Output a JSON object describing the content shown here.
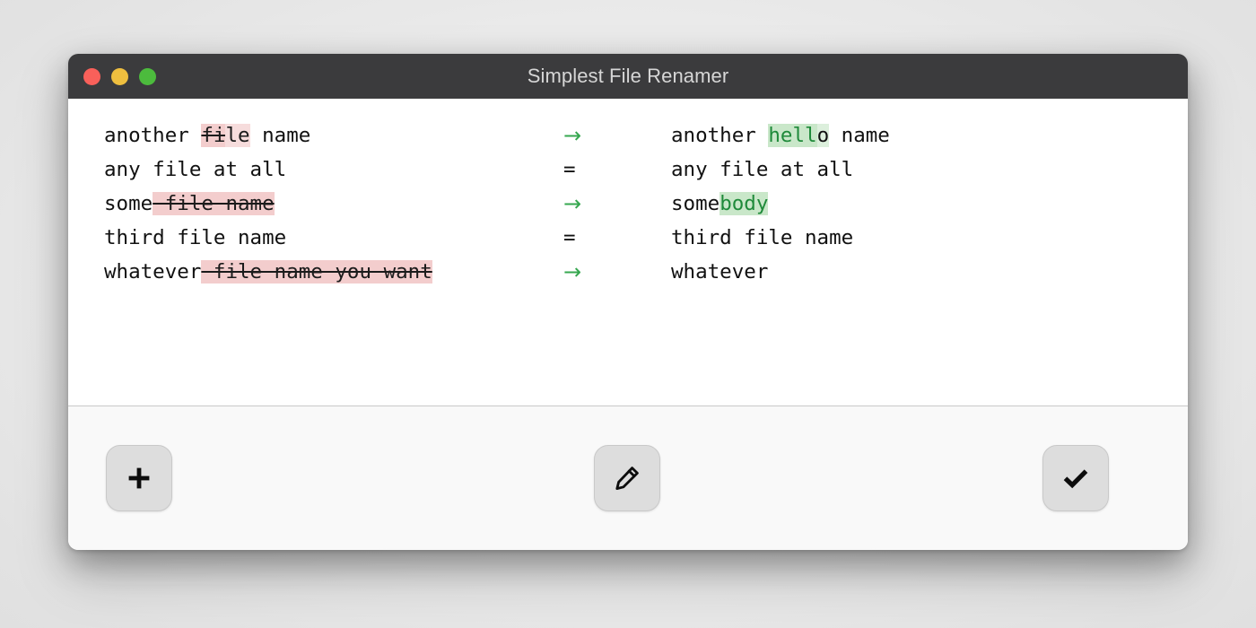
{
  "window": {
    "title": "Simplest File Renamer",
    "traffic_lights": [
      {
        "name": "close",
        "color": "#f9605a"
      },
      {
        "name": "minimize",
        "color": "#efbf3f"
      },
      {
        "name": "maximize",
        "color": "#4cbb3d"
      }
    ]
  },
  "colors": {
    "titlebar_bg": "#3b3b3d",
    "title_text": "#d6d6d6",
    "body_bg": "#ffffff",
    "toolbar_bg": "#f9f9f9",
    "delete_highlight": "#f3cdcd",
    "insert_highlight": "#c9e7c9",
    "insert_text": "#1f8a3a",
    "arrow_green": "#36a74f",
    "button_bg": "#dddddd"
  },
  "operators": {
    "changed": "→",
    "unchanged": "="
  },
  "rows": [
    {
      "id": "row-1",
      "operator": "changed",
      "old": [
        {
          "text": "another ",
          "kind": "same"
        },
        {
          "text": "fi",
          "kind": "del"
        },
        {
          "text": "le",
          "kind": "del-plain"
        },
        {
          "text": " name",
          "kind": "same"
        }
      ],
      "new": [
        {
          "text": "another ",
          "kind": "same"
        },
        {
          "text": "hell",
          "kind": "ins"
        },
        {
          "text": "o",
          "kind": "ins-plain"
        },
        {
          "text": " name",
          "kind": "same"
        }
      ],
      "old_plain": "another file name",
      "new_plain": "another hello name"
    },
    {
      "id": "row-2",
      "operator": "unchanged",
      "old": [
        {
          "text": "any file at all",
          "kind": "same"
        }
      ],
      "new": [
        {
          "text": "any file at all",
          "kind": "same"
        }
      ],
      "old_plain": "any file at all",
      "new_plain": "any file at all"
    },
    {
      "id": "row-3",
      "operator": "changed",
      "old": [
        {
          "text": "some",
          "kind": "same"
        },
        {
          "text": " file name",
          "kind": "del"
        }
      ],
      "new": [
        {
          "text": "some",
          "kind": "same"
        },
        {
          "text": "body",
          "kind": "ins"
        }
      ],
      "old_plain": "some file name",
      "new_plain": "somebody"
    },
    {
      "id": "row-4",
      "operator": "unchanged",
      "old": [
        {
          "text": "third file name",
          "kind": "same"
        }
      ],
      "new": [
        {
          "text": "third file name",
          "kind": "same"
        }
      ],
      "old_plain": "third file name",
      "new_plain": "third file name"
    },
    {
      "id": "row-5",
      "operator": "changed",
      "old": [
        {
          "text": "whatever",
          "kind": "same"
        },
        {
          "text": " file name you want",
          "kind": "del"
        }
      ],
      "new": [
        {
          "text": "whatever",
          "kind": "same"
        }
      ],
      "old_plain": "whatever file name you want",
      "new_plain": "whatever"
    }
  ],
  "toolbar": {
    "buttons": [
      {
        "id": "add",
        "icon": "plus-icon",
        "label": "Add files"
      },
      {
        "id": "edit",
        "icon": "pencil-icon",
        "label": "Edit rename rule"
      },
      {
        "id": "apply",
        "icon": "checkmark-icon",
        "label": "Apply renames"
      }
    ]
  }
}
